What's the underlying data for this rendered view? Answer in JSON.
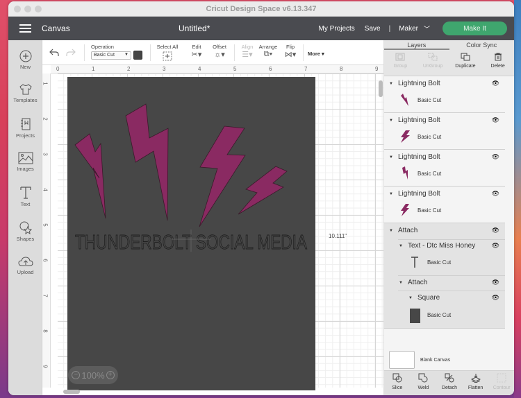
{
  "window": {
    "title": "Cricut Design Space  v6.13.347"
  },
  "header": {
    "section": "Canvas",
    "doc_title": "Untitled*",
    "my_projects": "My Projects",
    "save": "Save",
    "separator": "|",
    "machine": "Maker",
    "make_it": "Make It"
  },
  "leftbar": {
    "items": [
      {
        "label": "New",
        "icon": "plus-circle-icon"
      },
      {
        "label": "Templates",
        "icon": "tshirt-icon"
      },
      {
        "label": "Projects",
        "icon": "notebook-icon"
      },
      {
        "label": "Images",
        "icon": "image-icon"
      },
      {
        "label": "Text",
        "icon": "text-t-icon"
      },
      {
        "label": "Shapes",
        "icon": "shapes-icon"
      },
      {
        "label": "Upload",
        "icon": "upload-cloud-icon"
      }
    ]
  },
  "toolbar": {
    "operation_label": "Operation",
    "operation_value": "Basic Cut",
    "select_all": "Select All",
    "edit": "Edit",
    "offset": "Offset",
    "align": "Align",
    "arrange": "Arrange",
    "flip": "Flip",
    "more": "More ▾",
    "operation_color": "#444444"
  },
  "canvas": {
    "ruler_top": [
      "0",
      "1",
      "2",
      "3",
      "4",
      "5",
      "6",
      "7",
      "8",
      "9"
    ],
    "ruler_left": [
      "1",
      "2",
      "3",
      "4",
      "5",
      "6",
      "7",
      "8",
      "9"
    ],
    "text": "THUNDERBOLT SOCIAL MEDIA",
    "dimension": "10.111\"",
    "zoom": "100%",
    "mat_color": "#474747",
    "bolt_color": "#8a2a62"
  },
  "panel": {
    "tabs": [
      "Layers",
      "Color Sync"
    ],
    "actions": [
      {
        "label": "Group",
        "enabled": false
      },
      {
        "label": "UnGroup",
        "enabled": false
      },
      {
        "label": "Duplicate",
        "enabled": true
      },
      {
        "label": "Delete",
        "enabled": true
      }
    ],
    "layers": [
      {
        "name": "Lightning Bolt",
        "op": "Basic Cut"
      },
      {
        "name": "Lightning Bolt",
        "op": "Basic Cut"
      },
      {
        "name": "Lightning Bolt",
        "op": "Basic Cut"
      },
      {
        "name": "Lightning Bolt",
        "op": "Basic Cut"
      }
    ],
    "attach": {
      "name": "Attach",
      "text_layer": "Text - Dtc Miss Honey",
      "text_op": "Basic Cut",
      "inner_attach": "Attach",
      "square": "Square",
      "square_op": "Basic Cut"
    },
    "blank_canvas": "Blank Canvas",
    "bottom": [
      {
        "label": "Slice",
        "enabled": true
      },
      {
        "label": "Weld",
        "enabled": true
      },
      {
        "label": "Detach",
        "enabled": true
      },
      {
        "label": "Flatten",
        "enabled": true
      },
      {
        "label": "Contour",
        "enabled": false
      }
    ]
  }
}
